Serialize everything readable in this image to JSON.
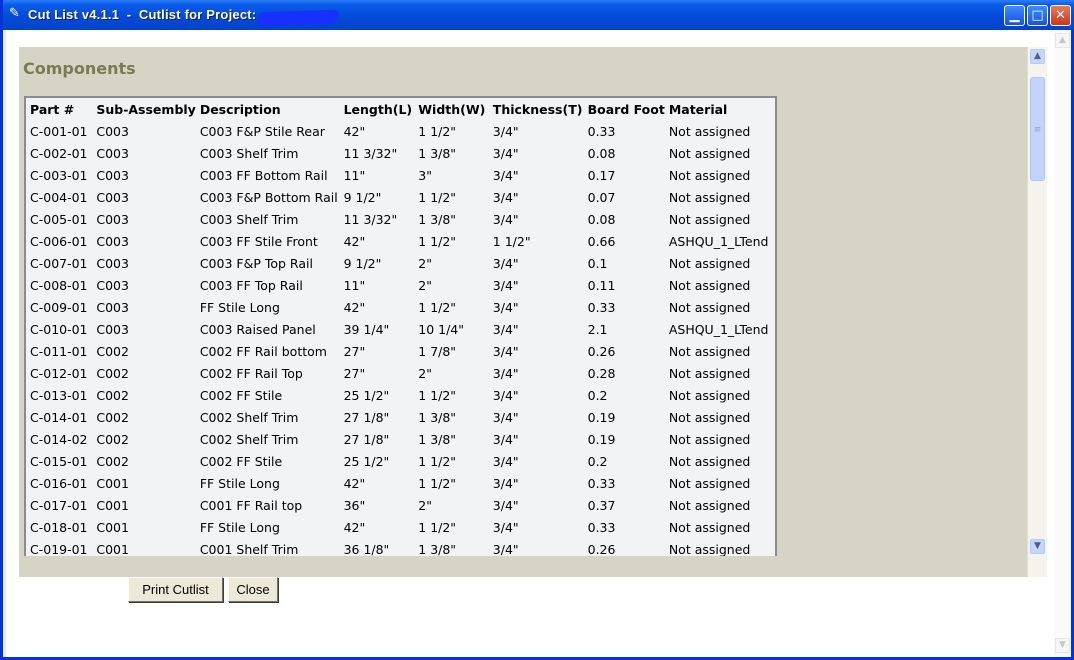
{
  "window": {
    "title": "Cut List v4.1.1  -  Cutlist for Project:"
  },
  "panel": {
    "section_title": "Components"
  },
  "table": {
    "headers": [
      "Part #",
      "Sub-Assembly",
      "Description",
      "Length(L)",
      "Width(W)",
      "Thickness(T)",
      "Board Foot",
      "Material"
    ],
    "rows": [
      [
        "C-001-01",
        "C003",
        "C003 F&P Stile Rear",
        "42\"",
        "1 1/2\"",
        "3/4\"",
        "0.33",
        "Not assigned"
      ],
      [
        "C-002-01",
        "C003",
        "C003 Shelf Trim",
        "11 3/32\"",
        "1 3/8\"",
        "3/4\"",
        "0.08",
        "Not assigned"
      ],
      [
        "C-003-01",
        "C003",
        "C003 FF Bottom Rail",
        "11\"",
        "3\"",
        "3/4\"",
        "0.17",
        "Not assigned"
      ],
      [
        "C-004-01",
        "C003",
        "C003 F&P Bottom Rail",
        "9 1/2\"",
        "1 1/2\"",
        "3/4\"",
        "0.07",
        "Not assigned"
      ],
      [
        "C-005-01",
        "C003",
        "C003 Shelf Trim",
        "11 3/32\"",
        "1 3/8\"",
        "3/4\"",
        "0.08",
        "Not assigned"
      ],
      [
        "C-006-01",
        "C003",
        "C003 FF Stile Front",
        "42\"",
        "1 1/2\"",
        "1 1/2\"",
        "0.66",
        "ASHQU_1_LTend"
      ],
      [
        "C-007-01",
        "C003",
        "C003 F&P Top Rail",
        "9 1/2\"",
        "2\"",
        "3/4\"",
        "0.1",
        "Not assigned"
      ],
      [
        "C-008-01",
        "C003",
        "C003 FF Top Rail",
        "11\"",
        "2\"",
        "3/4\"",
        "0.11",
        "Not assigned"
      ],
      [
        "C-009-01",
        "C003",
        "FF Stile Long",
        "42\"",
        "1 1/2\"",
        "3/4\"",
        "0.33",
        "Not assigned"
      ],
      [
        "C-010-01",
        "C003",
        "C003 Raised Panel",
        "39 1/4\"",
        "10 1/4\"",
        "3/4\"",
        "2.1",
        "ASHQU_1_LTend"
      ],
      [
        "C-011-01",
        "C002",
        "C002 FF Rail bottom",
        "27\"",
        "1 7/8\"",
        "3/4\"",
        "0.26",
        "Not assigned"
      ],
      [
        "C-012-01",
        "C002",
        "C002 FF Rail Top",
        "27\"",
        "2\"",
        "3/4\"",
        "0.28",
        "Not assigned"
      ],
      [
        "C-013-01",
        "C002",
        "C002 FF Stile",
        "25 1/2\"",
        "1 1/2\"",
        "3/4\"",
        "0.2",
        "Not assigned"
      ],
      [
        "C-014-01",
        "C002",
        "C002 Shelf Trim",
        "27 1/8\"",
        "1 3/8\"",
        "3/4\"",
        "0.19",
        "Not assigned"
      ],
      [
        "C-014-02",
        "C002",
        "C002 Shelf Trim",
        "27 1/8\"",
        "1 3/8\"",
        "3/4\"",
        "0.19",
        "Not assigned"
      ],
      [
        "C-015-01",
        "C002",
        "C002 FF Stile",
        "25 1/2\"",
        "1 1/2\"",
        "3/4\"",
        "0.2",
        "Not assigned"
      ],
      [
        "C-016-01",
        "C001",
        "FF Stile Long",
        "42\"",
        "1 1/2\"",
        "3/4\"",
        "0.33",
        "Not assigned"
      ],
      [
        "C-017-01",
        "C001",
        "C001 FF Rail top",
        "36\"",
        "2\"",
        "3/4\"",
        "0.37",
        "Not assigned"
      ],
      [
        "C-018-01",
        "C001",
        "FF Stile Long",
        "42\"",
        "1 1/2\"",
        "3/4\"",
        "0.33",
        "Not assigned"
      ],
      [
        "C-019-01",
        "C001",
        "C001 Shelf Trim",
        "36 1/8\"",
        "1 3/8\"",
        "3/4\"",
        "0.26",
        "Not assigned"
      ]
    ]
  },
  "buttons": {
    "print_label": "Print Cutlist",
    "close_label": "Close"
  },
  "icons": {
    "app": "pencil-icon",
    "minimize": "minimize-icon",
    "maximize": "maximize-icon",
    "close": "close-icon"
  }
}
